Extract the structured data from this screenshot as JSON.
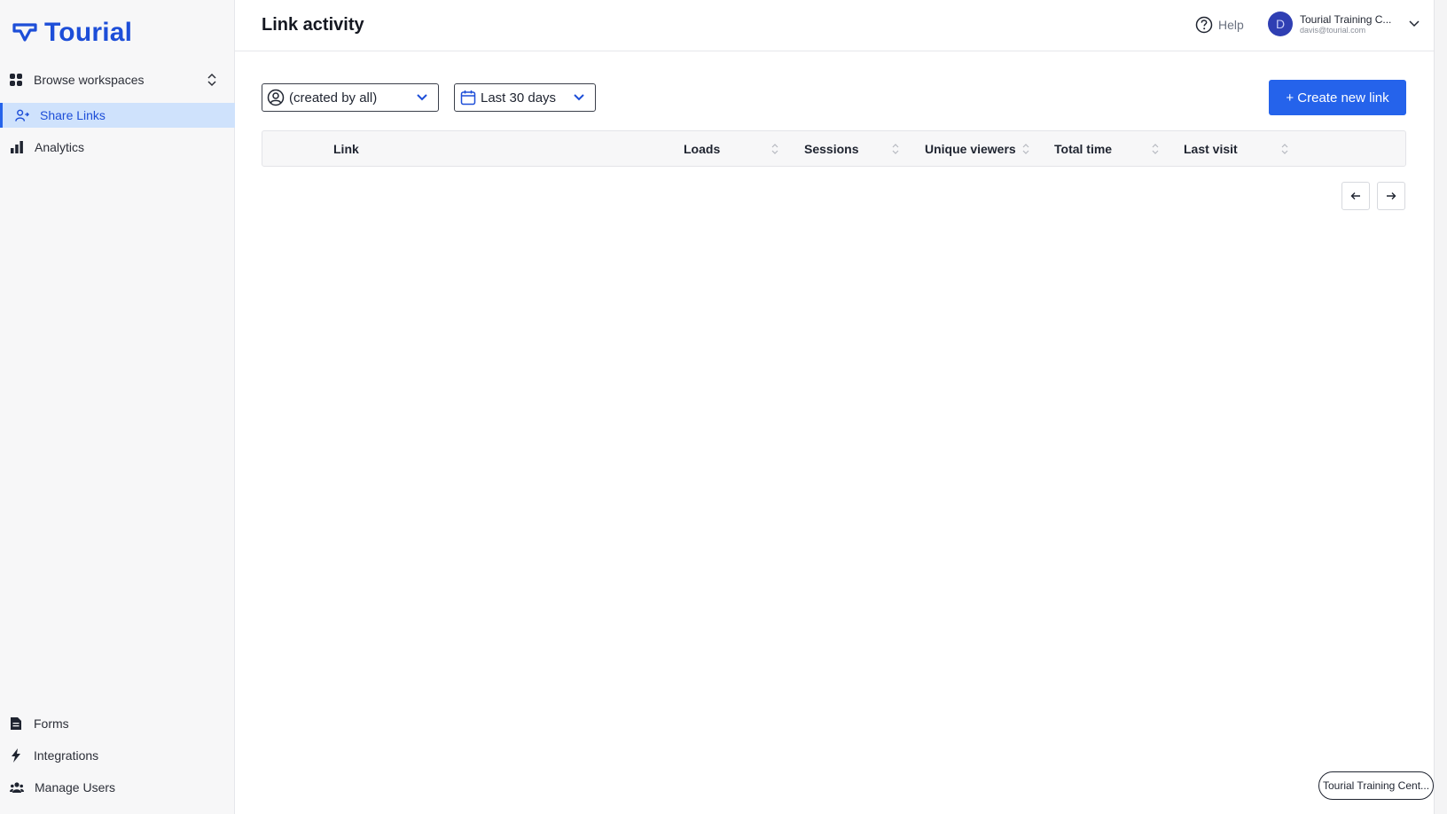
{
  "brand": {
    "name": "Tourial",
    "color": "#1d4ed8"
  },
  "sidebar": {
    "browse_label": "Browse workspaces",
    "items": [
      {
        "label": "Share Links",
        "icon": "share-users-icon",
        "active": true
      },
      {
        "label": "Analytics",
        "icon": "bar-chart-icon",
        "active": false
      }
    ],
    "bottom_items": [
      {
        "label": "Forms",
        "icon": "document-icon"
      },
      {
        "label": "Integrations",
        "icon": "lightning-icon"
      },
      {
        "label": "Manage Users",
        "icon": "users-icon"
      }
    ]
  },
  "header": {
    "title": "Link activity",
    "help_label": "Help",
    "user": {
      "initial": "D",
      "name": "Tourial Training C...",
      "email": "davis@tourial.com"
    }
  },
  "filters": {
    "creator": "(created by all)",
    "date_range": "Last 30 days"
  },
  "actions": {
    "create_label": "+ Create new link"
  },
  "table": {
    "columns": [
      "Link",
      "Loads",
      "Sessions",
      "Unique viewers",
      "Total time",
      "Last visit"
    ],
    "rows": []
  },
  "pagination": {
    "prev_icon": "arrow-left-icon",
    "next_icon": "arrow-right-icon"
  },
  "workspace_chip": "Tourial Training Cent...",
  "colors": {
    "accent": "#2563eb",
    "active_bg": "#cfe2fc",
    "sidebar_bg": "#f7f7f8"
  }
}
